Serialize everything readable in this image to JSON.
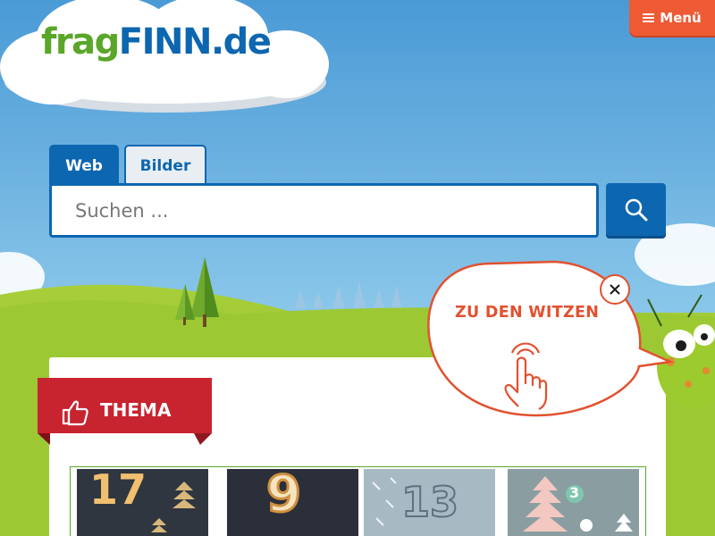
{
  "logo": {
    "part1": "frag",
    "part2": "FINN",
    "part3": ".de"
  },
  "menu": {
    "icon": "hamburger-icon",
    "label": "Menü"
  },
  "search": {
    "tabs": [
      {
        "label": "Web",
        "active": true
      },
      {
        "label": "Bilder",
        "active": false
      }
    ],
    "placeholder": "Suchen ...",
    "value": "",
    "button_icon": "search-icon"
  },
  "bubble": {
    "label": "ZU DEN WITZEN",
    "icon": "pointing-hand-icon",
    "close_icon": "close-icon"
  },
  "thema": {
    "label": "THEMA",
    "icon": "thumbs-up-icon"
  },
  "tiles": [
    {
      "number": "17"
    },
    {
      "number": "9"
    },
    {
      "number": "13"
    },
    {
      "number": "3"
    }
  ],
  "colors": {
    "brand_blue": "#0d66b0",
    "brand_green": "#5aa629",
    "accent_orange": "#ee5a34",
    "ribbon_red": "#c8242f"
  }
}
